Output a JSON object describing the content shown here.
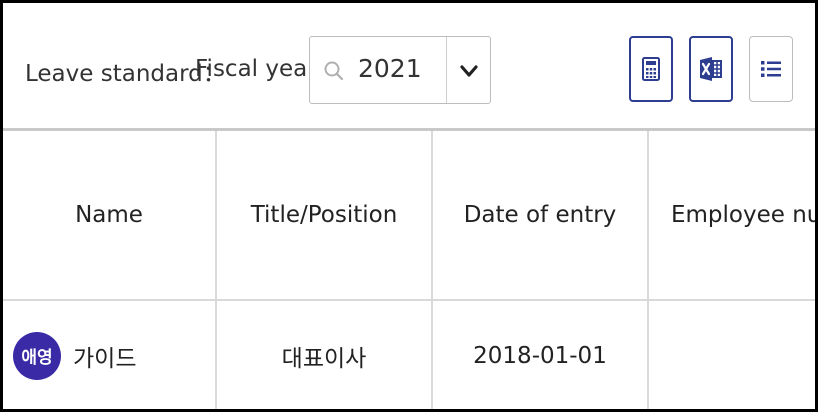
{
  "toolbar": {
    "leave_standard_label": "Leave standard：",
    "leave_standard_value": "Fiscal year",
    "year_select": {
      "value": "2021"
    },
    "buttons": {
      "calculator": "calculator-icon",
      "excel": "excel-icon",
      "list": "list-icon"
    }
  },
  "table": {
    "headers": [
      "Name",
      "Title/Position",
      "Date of entry",
      "Employee numb"
    ],
    "rows": [
      {
        "avatar": "애영",
        "name": "가이드",
        "title": "대표이사",
        "date_of_entry": "2018-01-01",
        "employee_number": ""
      }
    ]
  },
  "colors": {
    "accent": "#2d3d8f",
    "avatar_bg": "#3a2aa6",
    "border": "#d9d9d9"
  }
}
